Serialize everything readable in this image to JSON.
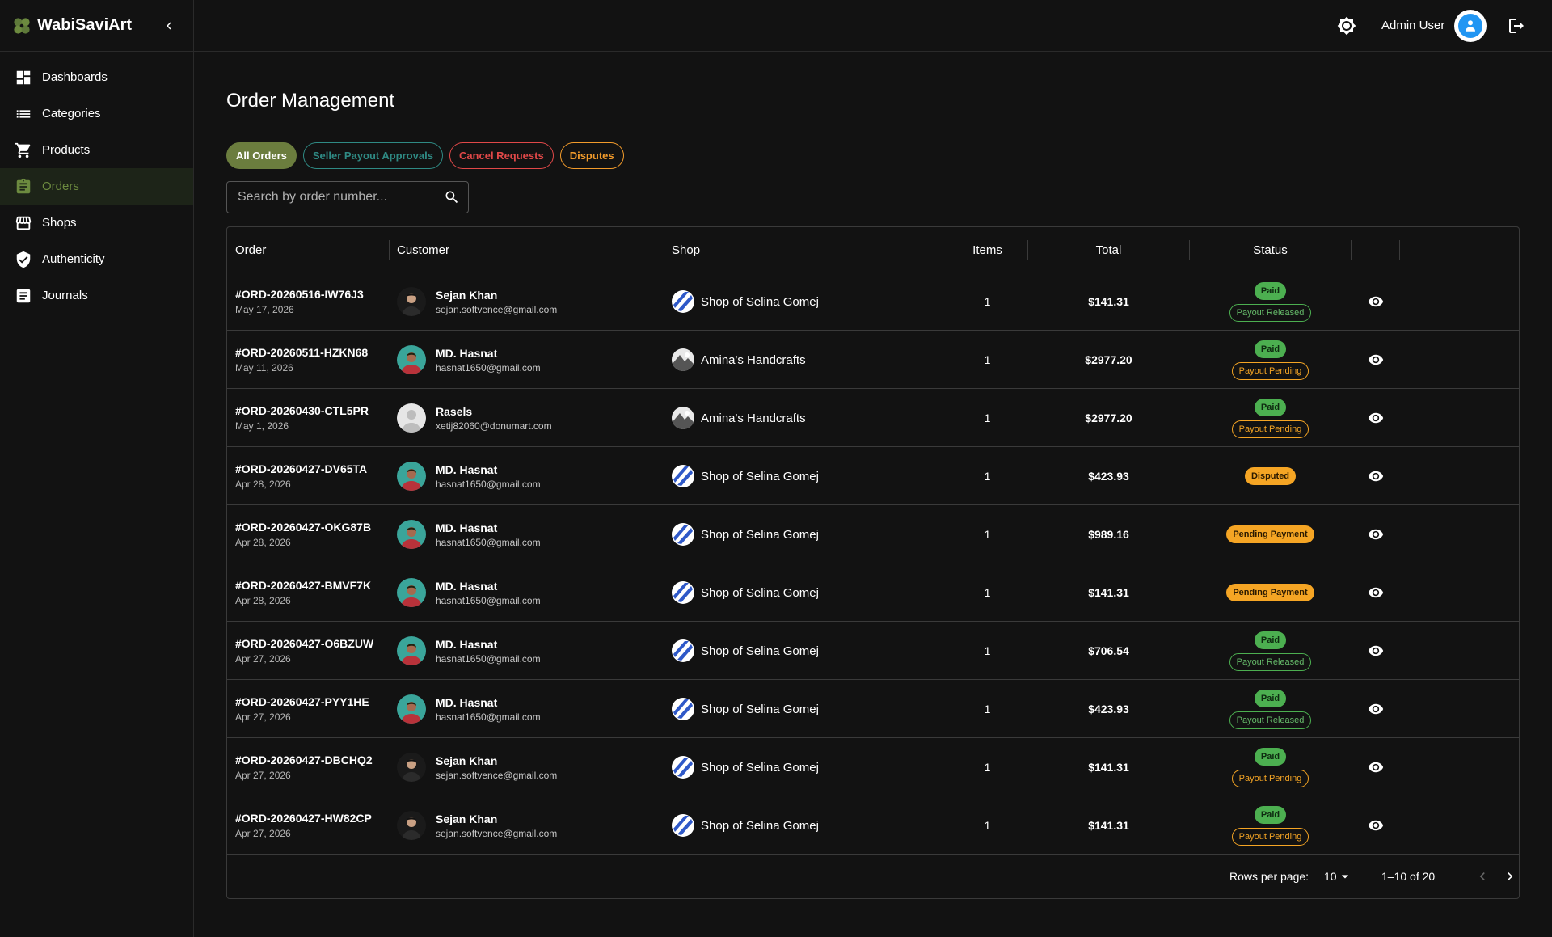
{
  "app": {
    "name": "WabiSaviArt"
  },
  "sidebar": {
    "items": [
      {
        "label": "Dashboards",
        "icon": "dashboard-icon"
      },
      {
        "label": "Categories",
        "icon": "list-icon"
      },
      {
        "label": "Products",
        "icon": "cart-icon"
      },
      {
        "label": "Orders",
        "icon": "clipboard-icon",
        "active": true
      },
      {
        "label": "Shops",
        "icon": "store-icon"
      },
      {
        "label": "Authenticity",
        "icon": "verified-shield-icon"
      },
      {
        "label": "Journals",
        "icon": "article-icon"
      }
    ]
  },
  "header": {
    "user_name": "Admin User"
  },
  "page": {
    "title": "Order Management"
  },
  "tabs": [
    "All Orders",
    "Seller Payout Approvals",
    "Cancel Requests",
    "Disputes"
  ],
  "search": {
    "placeholder": "Search by order number..."
  },
  "table": {
    "columns": [
      "Order",
      "Customer",
      "Shop",
      "Items",
      "Total",
      "Status",
      ""
    ],
    "rows": [
      {
        "order": "#ORD-20260516-IW76J3",
        "date": "May 17, 2026",
        "customer": "Sejan Khan",
        "email": "sejan.softvence@gmail.com",
        "avatar": "sejan",
        "shop": "Shop of Selina Gomej",
        "shop_logo": "blue",
        "items": "1",
        "total": "$141.31",
        "status": "Paid",
        "payout": "Payout Released"
      },
      {
        "order": "#ORD-20260511-HZKN68",
        "date": "May 11, 2026",
        "customer": "MD. Hasnat",
        "email": "hasnat1650@gmail.com",
        "avatar": "hasnat",
        "shop": "Amina's Handcrafts",
        "shop_logo": "gray",
        "items": "1",
        "total": "$2977.20",
        "status": "Paid",
        "payout": "Payout Pending"
      },
      {
        "order": "#ORD-20260430-CTL5PR",
        "date": "May 1, 2026",
        "customer": "Rasels",
        "email": "xetij82060@donumart.com",
        "avatar": "default",
        "shop": "Amina's Handcrafts",
        "shop_logo": "gray",
        "items": "1",
        "total": "$2977.20",
        "status": "Paid",
        "payout": "Payout Pending"
      },
      {
        "order": "#ORD-20260427-DV65TA",
        "date": "Apr 28, 2026",
        "customer": "MD. Hasnat",
        "email": "hasnat1650@gmail.com",
        "avatar": "hasnat",
        "shop": "Shop of Selina Gomej",
        "shop_logo": "blue",
        "items": "1",
        "total": "$423.93",
        "status": "Disputed",
        "payout": ""
      },
      {
        "order": "#ORD-20260427-OKG87B",
        "date": "Apr 28, 2026",
        "customer": "MD. Hasnat",
        "email": "hasnat1650@gmail.com",
        "avatar": "hasnat",
        "shop": "Shop of Selina Gomej",
        "shop_logo": "blue",
        "items": "1",
        "total": "$989.16",
        "status": "Pending Payment",
        "payout": ""
      },
      {
        "order": "#ORD-20260427-BMVF7K",
        "date": "Apr 28, 2026",
        "customer": "MD. Hasnat",
        "email": "hasnat1650@gmail.com",
        "avatar": "hasnat",
        "shop": "Shop of Selina Gomej",
        "shop_logo": "blue",
        "items": "1",
        "total": "$141.31",
        "status": "Pending Payment",
        "payout": ""
      },
      {
        "order": "#ORD-20260427-O6BZUW",
        "date": "Apr 27, 2026",
        "customer": "MD. Hasnat",
        "email": "hasnat1650@gmail.com",
        "avatar": "hasnat",
        "shop": "Shop of Selina Gomej",
        "shop_logo": "blue",
        "items": "1",
        "total": "$706.54",
        "status": "Paid",
        "payout": "Payout Released"
      },
      {
        "order": "#ORD-20260427-PYY1HE",
        "date": "Apr 27, 2026",
        "customer": "MD. Hasnat",
        "email": "hasnat1650@gmail.com",
        "avatar": "hasnat",
        "shop": "Shop of Selina Gomej",
        "shop_logo": "blue",
        "items": "1",
        "total": "$423.93",
        "status": "Paid",
        "payout": "Payout Released"
      },
      {
        "order": "#ORD-20260427-DBCHQ2",
        "date": "Apr 27, 2026",
        "customer": "Sejan Khan",
        "email": "sejan.softvence@gmail.com",
        "avatar": "sejan",
        "shop": "Shop of Selina Gomej",
        "shop_logo": "blue",
        "items": "1",
        "total": "$141.31",
        "status": "Paid",
        "payout": "Payout Pending"
      },
      {
        "order": "#ORD-20260427-HW82CP",
        "date": "Apr 27, 2026",
        "customer": "Sejan Khan",
        "email": "sejan.softvence@gmail.com",
        "avatar": "sejan",
        "shop": "Shop of Selina Gomej",
        "shop_logo": "blue",
        "items": "1",
        "total": "$141.31",
        "status": "Paid",
        "payout": "Payout Pending"
      }
    ]
  },
  "pagination": {
    "rows_per_page_label": "Rows per page:",
    "rows_per_page": "10",
    "range": "1–10 of 20"
  },
  "colors": {
    "accent": "#6b7d3e",
    "paid": "#4caf50",
    "warning": "#f5a524",
    "danger": "#e04848",
    "teal": "#2f8a84"
  }
}
